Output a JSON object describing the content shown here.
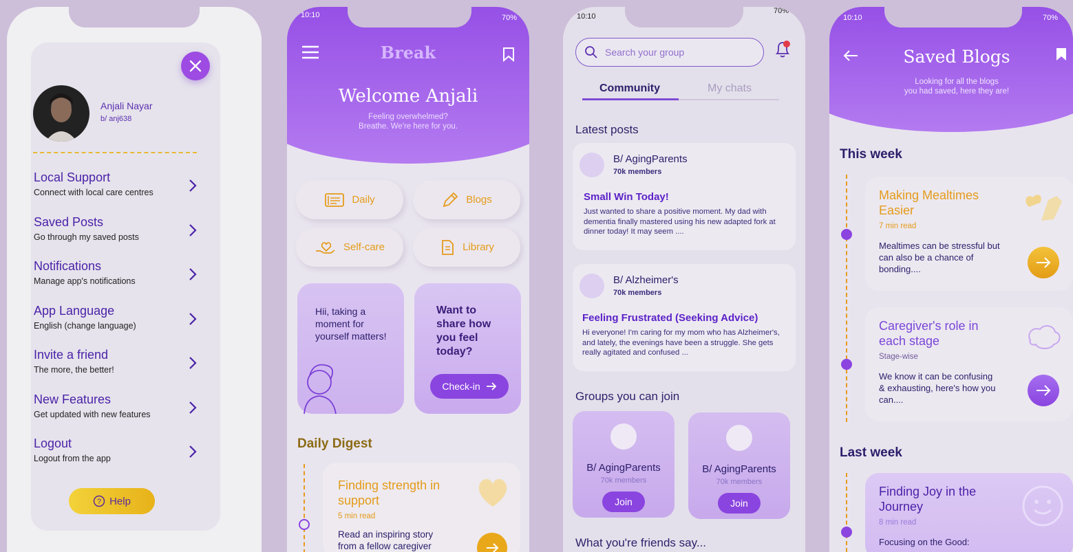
{
  "colors": {
    "accent": "#8a44df",
    "gold": "#e79a1c",
    "ink": "#2b1d6a"
  },
  "menu_screen": {
    "user": {
      "name": "Anjali Nayar",
      "handle": "b/ anj638"
    },
    "items": [
      {
        "title": "Local Support",
        "subtitle": "Connect with local care centres"
      },
      {
        "title": "Saved Posts",
        "subtitle": "Go through my saved posts"
      },
      {
        "title": "Notifications",
        "subtitle": "Manage app's notifications"
      },
      {
        "title": "App Language",
        "subtitle": "English (change language)"
      },
      {
        "title": "Invite a friend",
        "subtitle": "The more, the better!"
      },
      {
        "title": "New Features",
        "subtitle": "Get updated with new features"
      },
      {
        "title": "Logout",
        "subtitle": "Logout from the app"
      }
    ],
    "help_label": "Help"
  },
  "home_screen": {
    "time": "10:10",
    "battery": "70%",
    "logo": "Break",
    "welcome": "Welcome Anjali",
    "subtitle_line1": "Feeling overwhelmed?",
    "subtitle_line2": "Breathe. We're here for you.",
    "tiles": [
      "Daily",
      "Blogs",
      "Self-care",
      "Library"
    ],
    "selfcare_text": "Hii, taking a moment for yourself matters!",
    "checkin_prompt": "Want to share how you feel today?",
    "checkin_button": "Check-in",
    "digest_heading": "Daily Digest",
    "digest_card": {
      "title": "Finding strength in support",
      "read": "5 min read",
      "body": "Read an inspiring story from a fellow caregiver"
    }
  },
  "community_screen": {
    "time": "10:10",
    "battery": "70%",
    "search_placeholder": "Search your group",
    "tabs": [
      "Community",
      "My chats"
    ],
    "latest_heading": "Latest posts",
    "posts": [
      {
        "group": "B/ AgingParents",
        "members": "70k members",
        "title": "Small Win Today!",
        "body": "Just wanted to share a positive moment. My dad with dementia finally mastered using his new adapted fork at dinner today! It may seem ...."
      },
      {
        "group": "B/ Alzheimer's",
        "members": "70k members",
        "title": "Feeling Frustrated (Seeking Advice)",
        "body": "Hi everyone! I'm caring for my mom who has Alzheimer's, and lately, the evenings have been a struggle. She gets really agitated and confused ..."
      }
    ],
    "groups_heading": "Groups you can join",
    "groups": [
      {
        "name": "B/ AgingParents",
        "members": "70k members",
        "join": "Join"
      },
      {
        "name": "B/ AgingParents",
        "members": "70k members",
        "join": "Join"
      }
    ],
    "friends_heading": "What you're friends say..."
  },
  "saved_screen": {
    "time": "10:10",
    "battery": "70%",
    "title": "Saved Blogs",
    "subtitle_line1": "Looking for all the blogs",
    "subtitle_line2": "you had saved, here they are!",
    "this_week": "This week",
    "last_week": "Last week",
    "blogs": [
      {
        "title": "Making Mealtimes Easier",
        "read": "7 min read",
        "body": "Mealtimes can be stressful but can also be a chance of bonding...."
      },
      {
        "title": "Caregiver's role in each stage",
        "read": "Stage-wise",
        "body": "We know it can be confusing & exhausting, here's how you can...."
      },
      {
        "title": "Finding Joy in the Journey",
        "read": "8 min read",
        "body": "Focusing on the Good:"
      }
    ]
  }
}
